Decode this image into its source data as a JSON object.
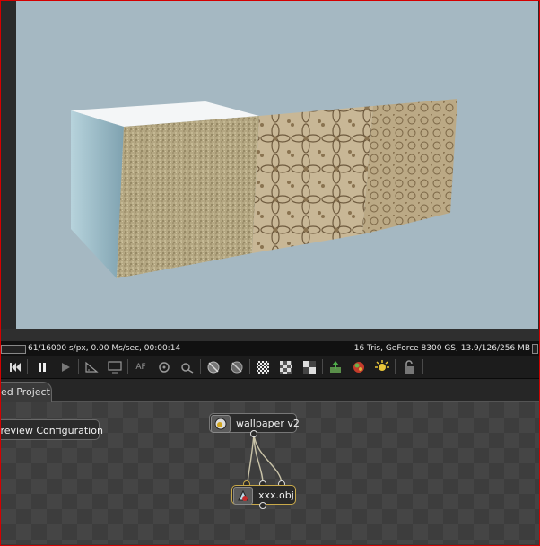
{
  "status": {
    "left_text": "61/16000 s/px, 0.00 Ms/sec, 00:00:14",
    "right_text": "16 Tris, GeForce 8300 GS, 13.9/126/256 MB"
  },
  "toolbar": {
    "buttons": [
      {
        "name": "rewind-icon"
      },
      {
        "name": "pause-icon"
      },
      {
        "name": "play-icon"
      },
      {
        "name": "ruler-icon"
      },
      {
        "name": "monitor-icon"
      },
      {
        "name": "af-icon",
        "label": "AF"
      },
      {
        "name": "camera-rotate-icon"
      },
      {
        "name": "zoom-camera-icon"
      },
      {
        "name": "sphere-grid-icon"
      },
      {
        "name": "sphere-cut-icon"
      },
      {
        "name": "checker-fine-icon"
      },
      {
        "name": "checker-medium-icon"
      },
      {
        "name": "checker-large-icon"
      },
      {
        "name": "export-icon"
      },
      {
        "name": "render-color-icon"
      },
      {
        "name": "light-icon"
      },
      {
        "name": "lock-icon"
      }
    ]
  },
  "tabs": {
    "project_label": "ed Project"
  },
  "graph": {
    "preview_button_label": "Preview Configuration",
    "nodes": [
      {
        "label": "wallpaper v2",
        "icon": "material-icon"
      },
      {
        "label": "xxx.obj",
        "icon": "mesh-icon"
      }
    ]
  },
  "colors": {
    "viewport_background": "#a5b8c2",
    "selection": "#c9a94a",
    "window_border": "#d40000"
  }
}
